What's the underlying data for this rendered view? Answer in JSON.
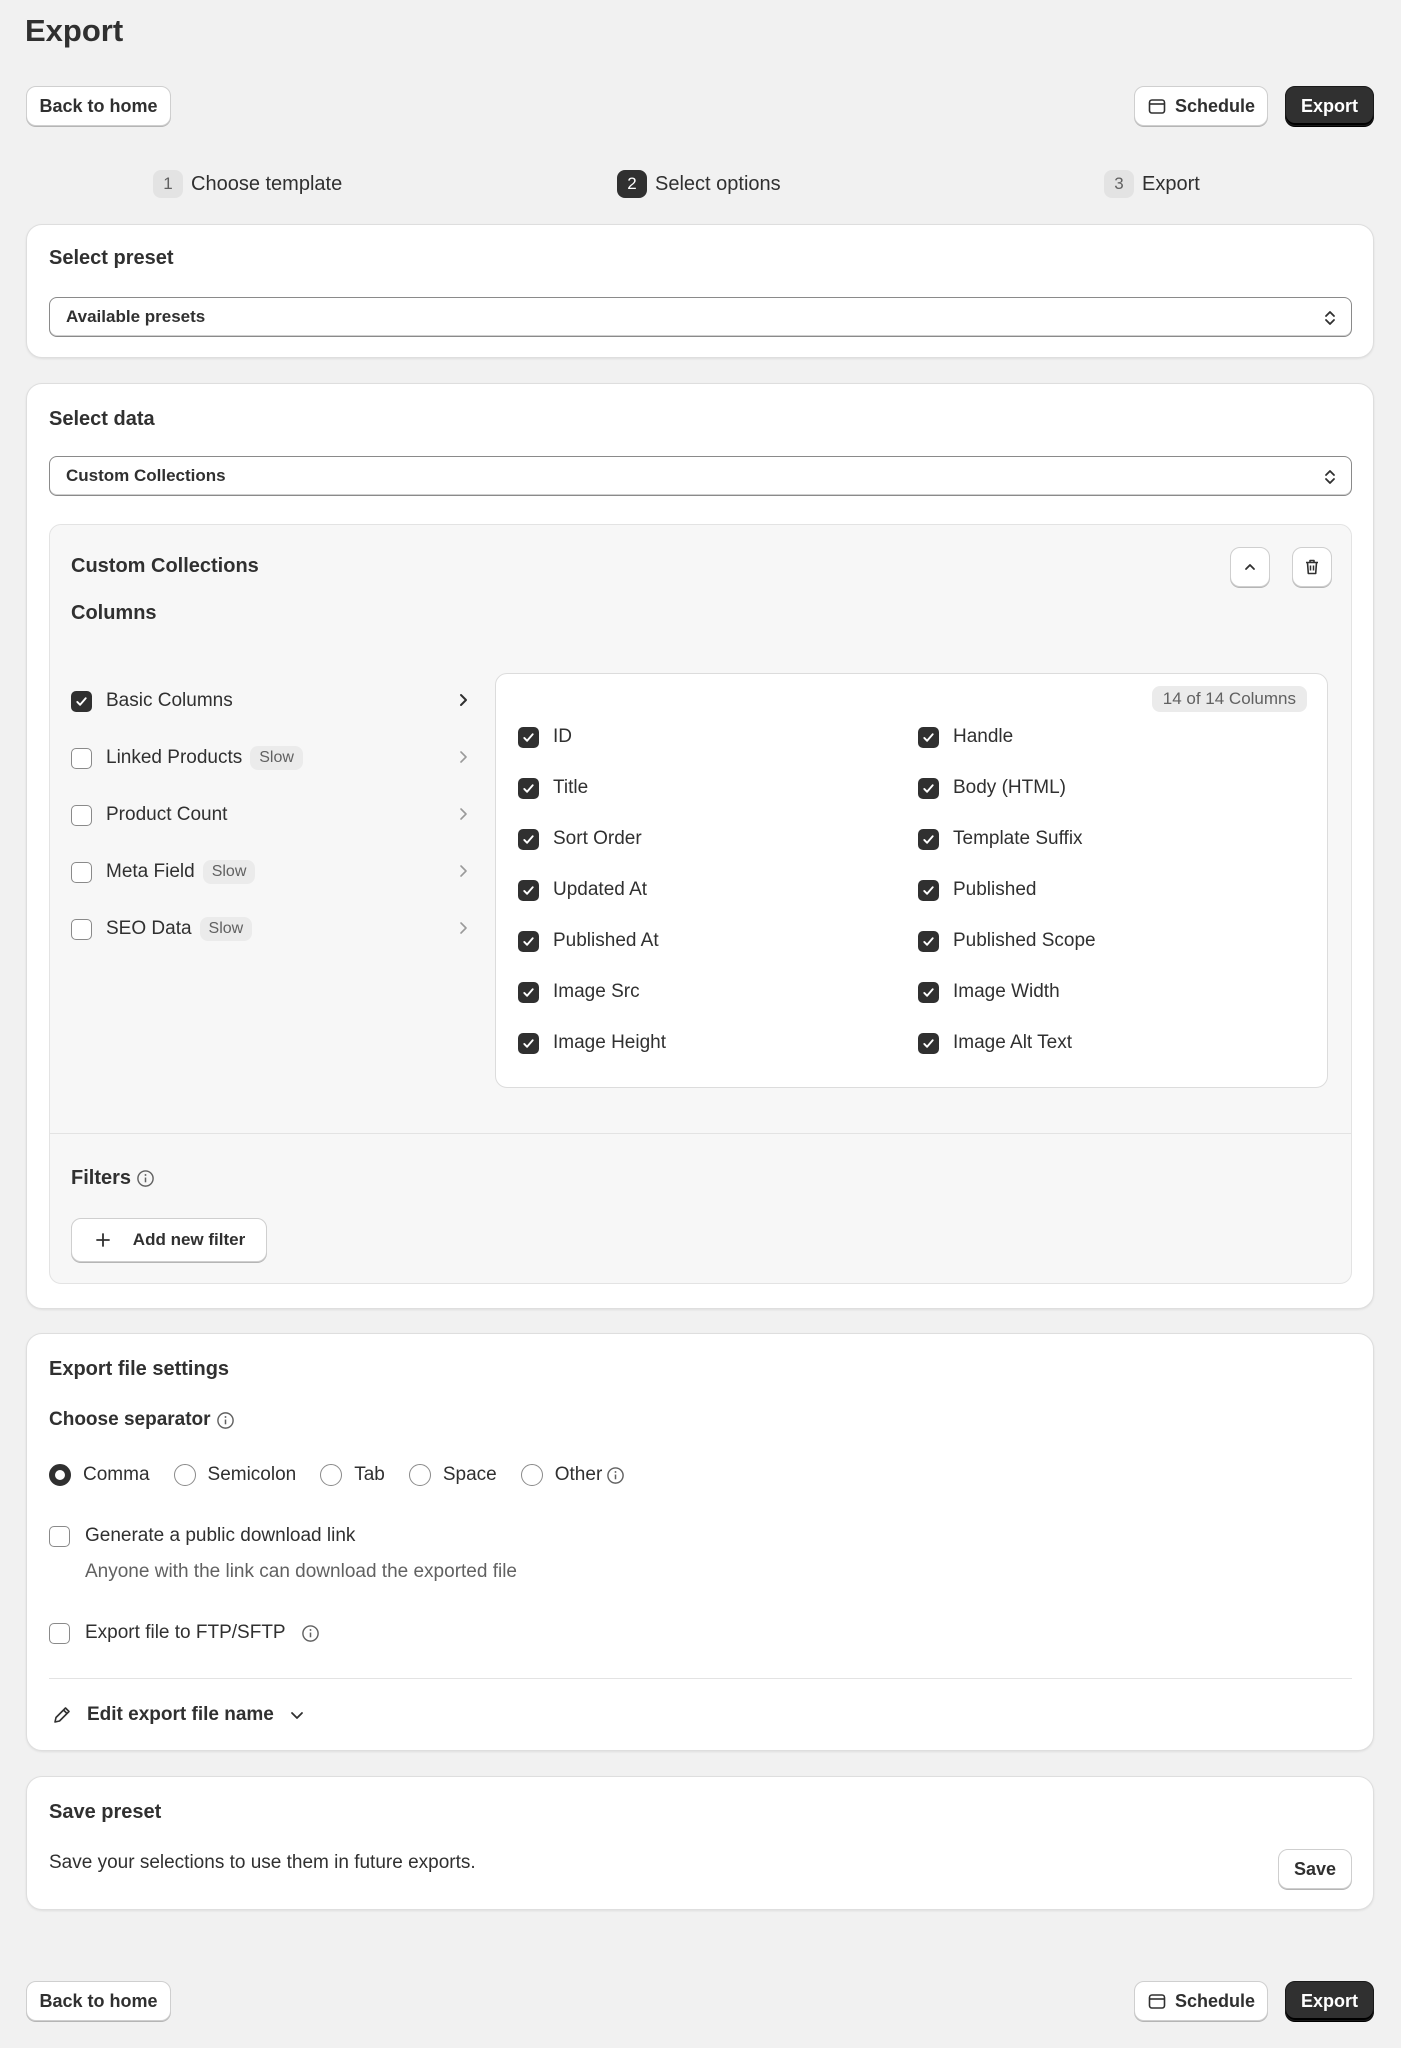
{
  "page": {
    "title": "Export"
  },
  "toolbar": {
    "back_label": "Back to home",
    "schedule_label": "Schedule",
    "export_label": "Export"
  },
  "steps": [
    {
      "num": "1",
      "label": "Choose template"
    },
    {
      "num": "2",
      "label": "Select options"
    },
    {
      "num": "3",
      "label": "Export"
    }
  ],
  "preset": {
    "title": "Select preset",
    "selected": "Available presets"
  },
  "data_section": {
    "title": "Select data",
    "selected": "Custom Collections",
    "panel_title": "Custom Collections",
    "columns_title": "Columns",
    "groups": [
      {
        "label": "Basic Columns",
        "checked": true,
        "badge": ""
      },
      {
        "label": "Linked Products",
        "checked": false,
        "badge": "Slow"
      },
      {
        "label": "Product Count",
        "checked": false,
        "badge": ""
      },
      {
        "label": "Meta Field",
        "checked": false,
        "badge": "Slow"
      },
      {
        "label": "SEO Data",
        "checked": false,
        "badge": "Slow"
      }
    ],
    "columns_count": "14 of 14 Columns",
    "columns": [
      "ID",
      "Handle",
      "Title",
      "Body (HTML)",
      "Sort Order",
      "Template Suffix",
      "Updated At",
      "Published",
      "Published At",
      "Published Scope",
      "Image Src",
      "Image Width",
      "Image Height",
      "Image Alt Text"
    ],
    "filters_title": "Filters",
    "add_filter_label": "Add new filter"
  },
  "file_settings": {
    "title": "Export file settings",
    "separator_label": "Choose separator",
    "separators": [
      "Comma",
      "Semicolon",
      "Tab",
      "Space",
      "Other"
    ],
    "selected_separator": "Comma",
    "public_link_label": "Generate a public download link",
    "public_link_help": "Anyone with the link can download the exported file",
    "ftp_label": "Export file to FTP/SFTP",
    "edit_name_label": "Edit export file name"
  },
  "save_preset": {
    "title": "Save preset",
    "description": "Save your selections to use them in future exports.",
    "save_label": "Save"
  }
}
